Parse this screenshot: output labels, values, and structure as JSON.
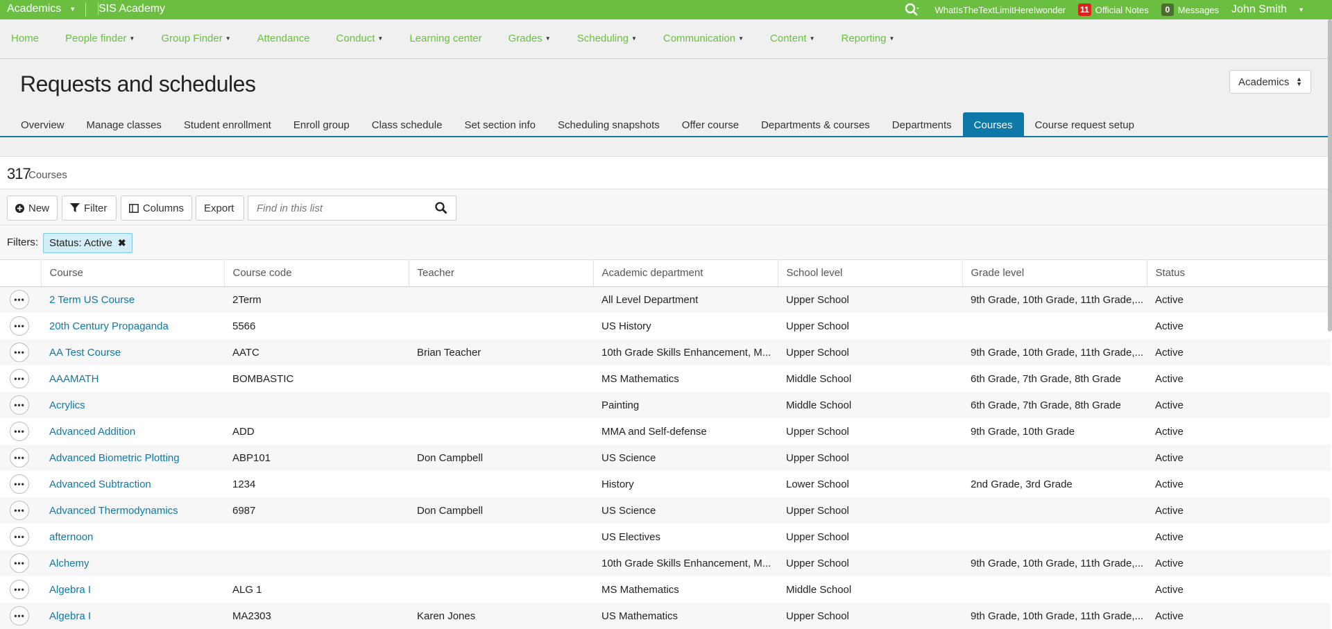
{
  "topbar": {
    "app_switcher": "Academics",
    "school_name": "SIS Academy",
    "user_link": "WhatIsTheTextLimitHereIwonder",
    "notes_count": "11",
    "notes_label": "Official Notes",
    "messages_count": "0",
    "messages_label": "Messages",
    "user_name": "John Smith"
  },
  "nav": {
    "items": [
      {
        "label": "Home",
        "dropdown": false
      },
      {
        "label": "People finder",
        "dropdown": true
      },
      {
        "label": "Group Finder",
        "dropdown": true
      },
      {
        "label": "Attendance",
        "dropdown": false
      },
      {
        "label": "Conduct",
        "dropdown": true
      },
      {
        "label": "Learning center",
        "dropdown": false
      },
      {
        "label": "Grades",
        "dropdown": true
      },
      {
        "label": "Scheduling",
        "dropdown": true
      },
      {
        "label": "Communication",
        "dropdown": true
      },
      {
        "label": "Content",
        "dropdown": true
      },
      {
        "label": "Reporting",
        "dropdown": true
      }
    ]
  },
  "page": {
    "title": "Requests and schedules",
    "context_select": "Academics",
    "tabs": [
      {
        "label": "Overview",
        "active": false
      },
      {
        "label": "Manage classes",
        "active": false
      },
      {
        "label": "Student enrollment",
        "active": false
      },
      {
        "label": "Enroll group",
        "active": false
      },
      {
        "label": "Class schedule",
        "active": false
      },
      {
        "label": "Set section info",
        "active": false
      },
      {
        "label": "Scheduling snapshots",
        "active": false
      },
      {
        "label": "Offer course",
        "active": false
      },
      {
        "label": "Departments & courses",
        "active": false
      },
      {
        "label": "Departments",
        "active": false
      },
      {
        "label": "Courses",
        "active": true
      },
      {
        "label": "Course request setup",
        "active": false
      }
    ]
  },
  "list": {
    "count": "317",
    "count_label": "Courses",
    "new_label": "New",
    "filter_label": "Filter",
    "columns_label": "Columns",
    "export_label": "Export",
    "search_placeholder": "Find in this list",
    "filters_label": "Filters:",
    "active_filter": "Status: Active"
  },
  "table": {
    "headers": [
      "Course",
      "Course code",
      "Teacher",
      "Academic department",
      "School level",
      "Grade level",
      "Status"
    ],
    "rows": [
      [
        "2 Term US Course",
        "2Term",
        "",
        "All Level Department",
        "Upper School",
        "9th Grade, 10th Grade, 11th Grade,...",
        "Active"
      ],
      [
        "20th Century Propaganda",
        "5566",
        "",
        "US History",
        "Upper School",
        "",
        "Active"
      ],
      [
        "AA Test Course",
        "AATC",
        "Brian Teacher",
        "10th Grade Skills Enhancement, M...",
        "Upper School",
        "9th Grade, 10th Grade, 11th Grade,...",
        "Active"
      ],
      [
        "AAAMATH",
        "BOMBASTIC",
        "",
        "MS Mathematics",
        "Middle School",
        "6th Grade, 7th Grade, 8th Grade",
        "Active"
      ],
      [
        "Acrylics",
        "",
        "",
        "Painting",
        "Middle School",
        "6th Grade, 7th Grade, 8th Grade",
        "Active"
      ],
      [
        "Advanced Addition",
        "ADD",
        "",
        "MMA and Self-defense",
        "Upper School",
        "9th Grade, 10th Grade",
        "Active"
      ],
      [
        "Advanced Biometric Plotting",
        "ABP101",
        "Don Campbell",
        "US Science",
        "Upper School",
        "",
        "Active"
      ],
      [
        "Advanced Subtraction",
        "1234",
        "",
        "History",
        "Lower School",
        "2nd Grade, 3rd Grade",
        "Active"
      ],
      [
        "Advanced Thermodynamics",
        "6987",
        "Don Campbell",
        "US Science",
        "Upper School",
        "",
        "Active"
      ],
      [
        "afternoon",
        "",
        "",
        "US Electives",
        "Upper School",
        "",
        "Active"
      ],
      [
        "Alchemy",
        "",
        "",
        "10th Grade Skills Enhancement, M...",
        "Upper School",
        "9th Grade, 10th Grade, 11th Grade,...",
        "Active"
      ],
      [
        "Algebra I",
        "ALG 1",
        "",
        "MS Mathematics",
        "Middle School",
        "",
        "Active"
      ],
      [
        "Algebra I",
        "MA2303",
        "Karen Jones",
        "US Mathematics",
        "Upper School",
        "9th Grade, 10th Grade, 11th Grade,...",
        "Active"
      ]
    ]
  },
  "colors": {
    "brand_green": "#6abf40",
    "accent_blue": "#0e78a8",
    "badge_red": "#d9241f"
  }
}
